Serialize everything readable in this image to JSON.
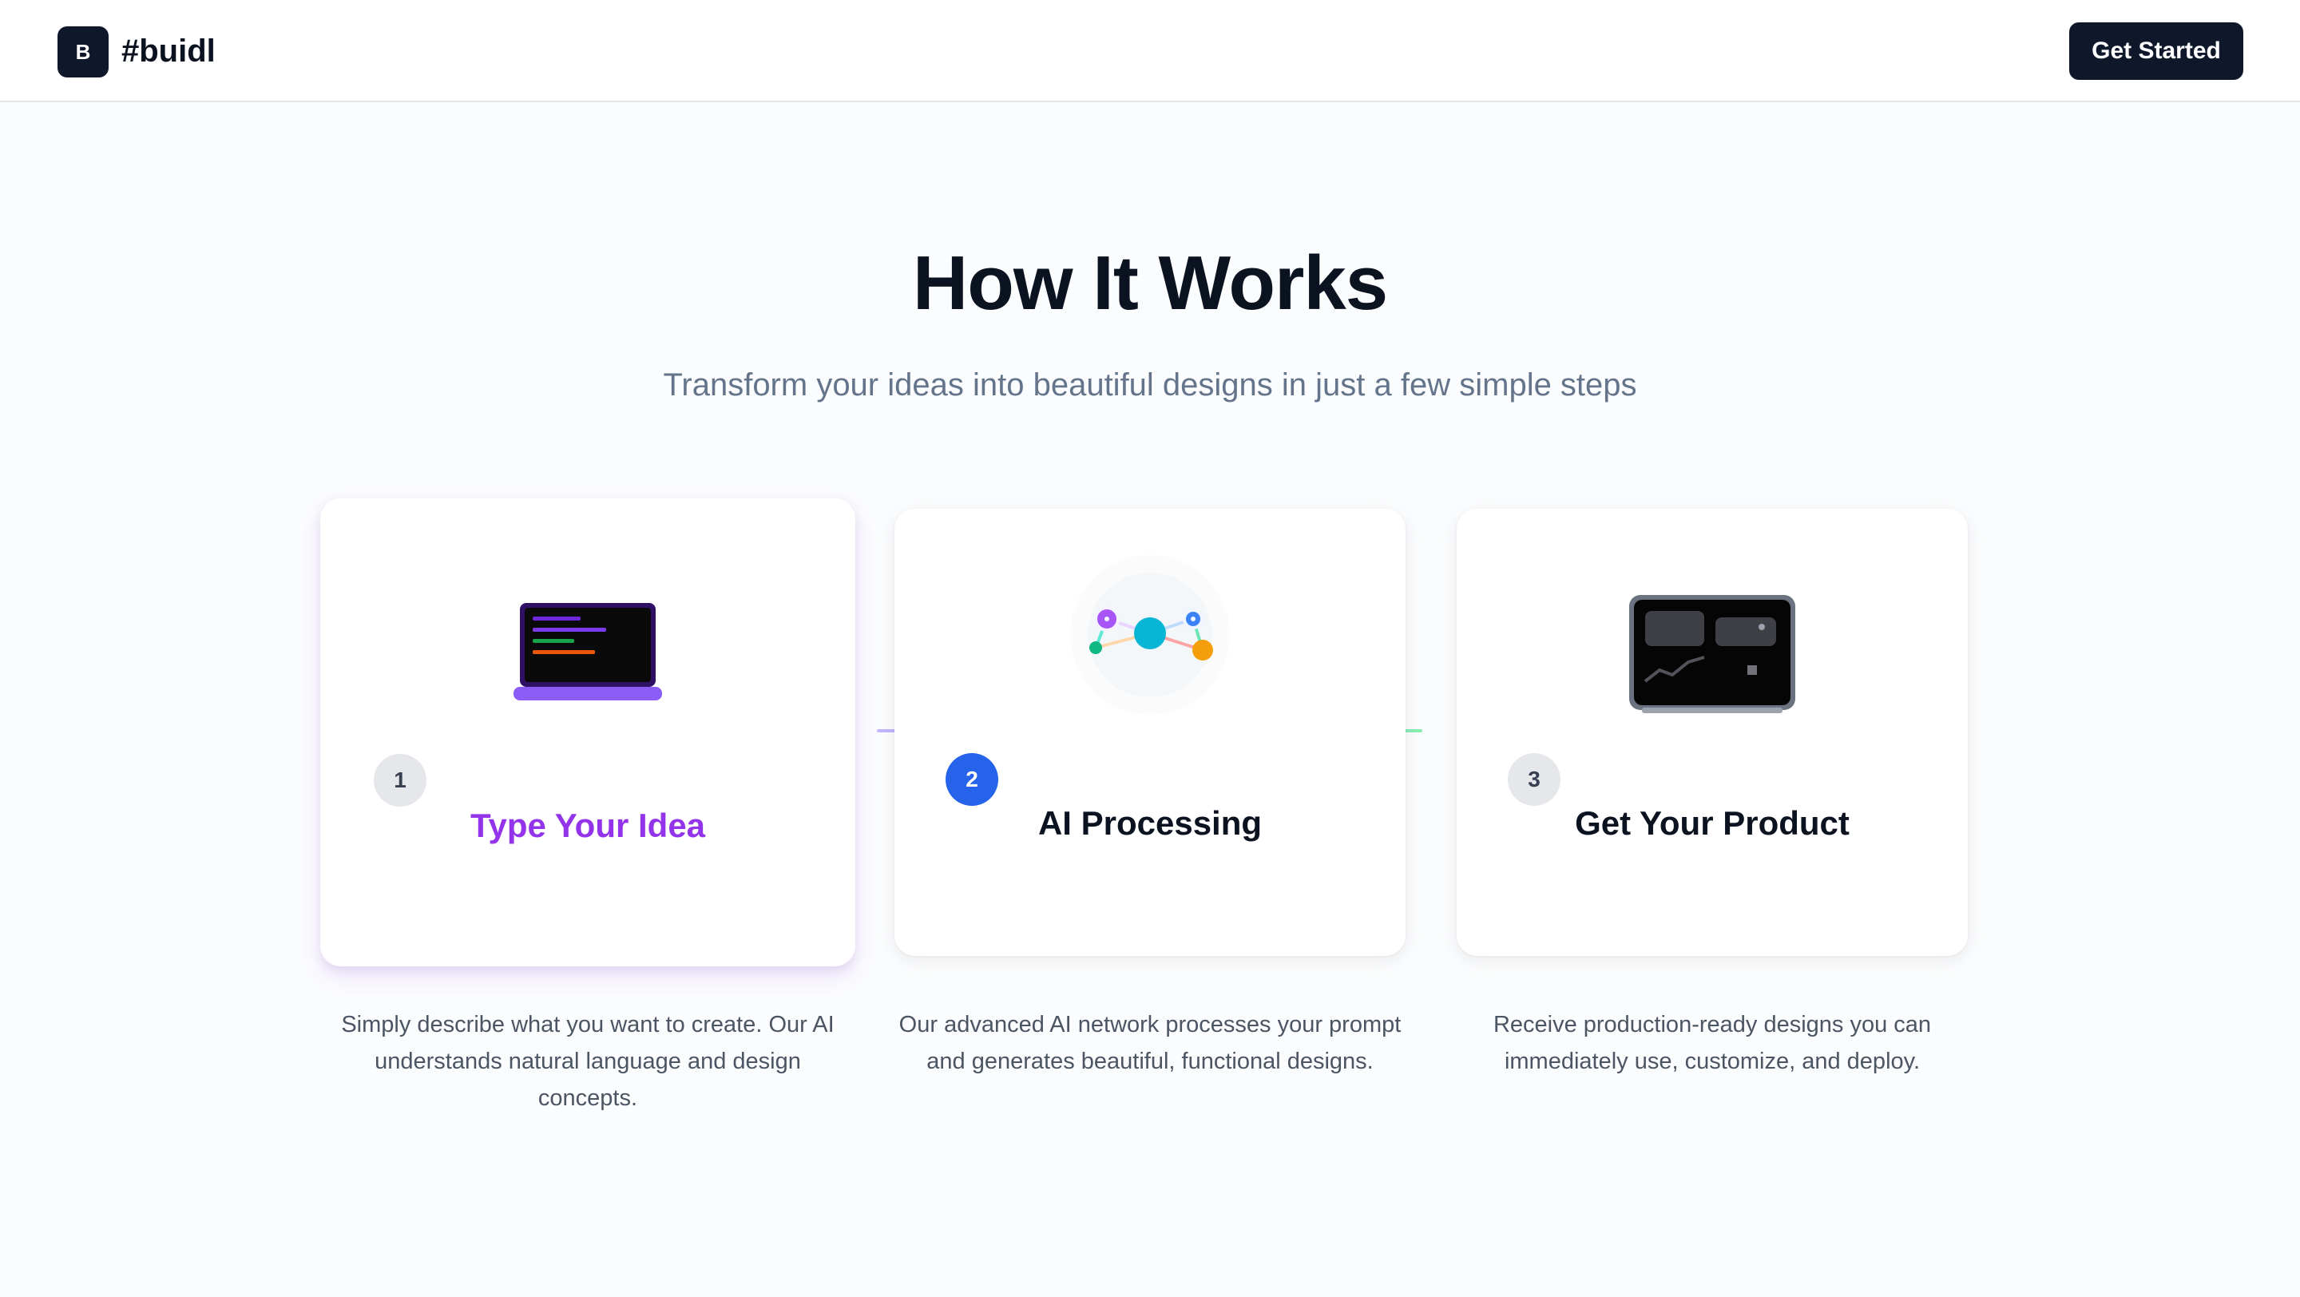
{
  "brand": {
    "logo_letter": "B",
    "name": "#buidl"
  },
  "header": {
    "cta_label": "Get Started"
  },
  "hero": {
    "title": "How It Works",
    "subtitle": "Transform your ideas into beautiful designs in just a few simple steps"
  },
  "steps": [
    {
      "number": "1",
      "title": "Type Your Idea",
      "description": "Simply describe what you want to create. Our AI understands natural language and design concepts.",
      "icon": "laptop-code-icon"
    },
    {
      "number": "2",
      "title": "AI Processing",
      "description": "Our advanced AI network processes your prompt and generates beautiful, functional designs.",
      "icon": "neural-network-icon"
    },
    {
      "number": "3",
      "title": "Get Your Product",
      "description": "Receive production-ready designs you can immediately use, customize, and deploy.",
      "icon": "dashboard-screen-icon"
    }
  ],
  "colors": {
    "primary_dark": "#0f172a",
    "active_step": "#9333ea",
    "step_badge_active": "#2563eb",
    "muted_text": "#64748b"
  }
}
